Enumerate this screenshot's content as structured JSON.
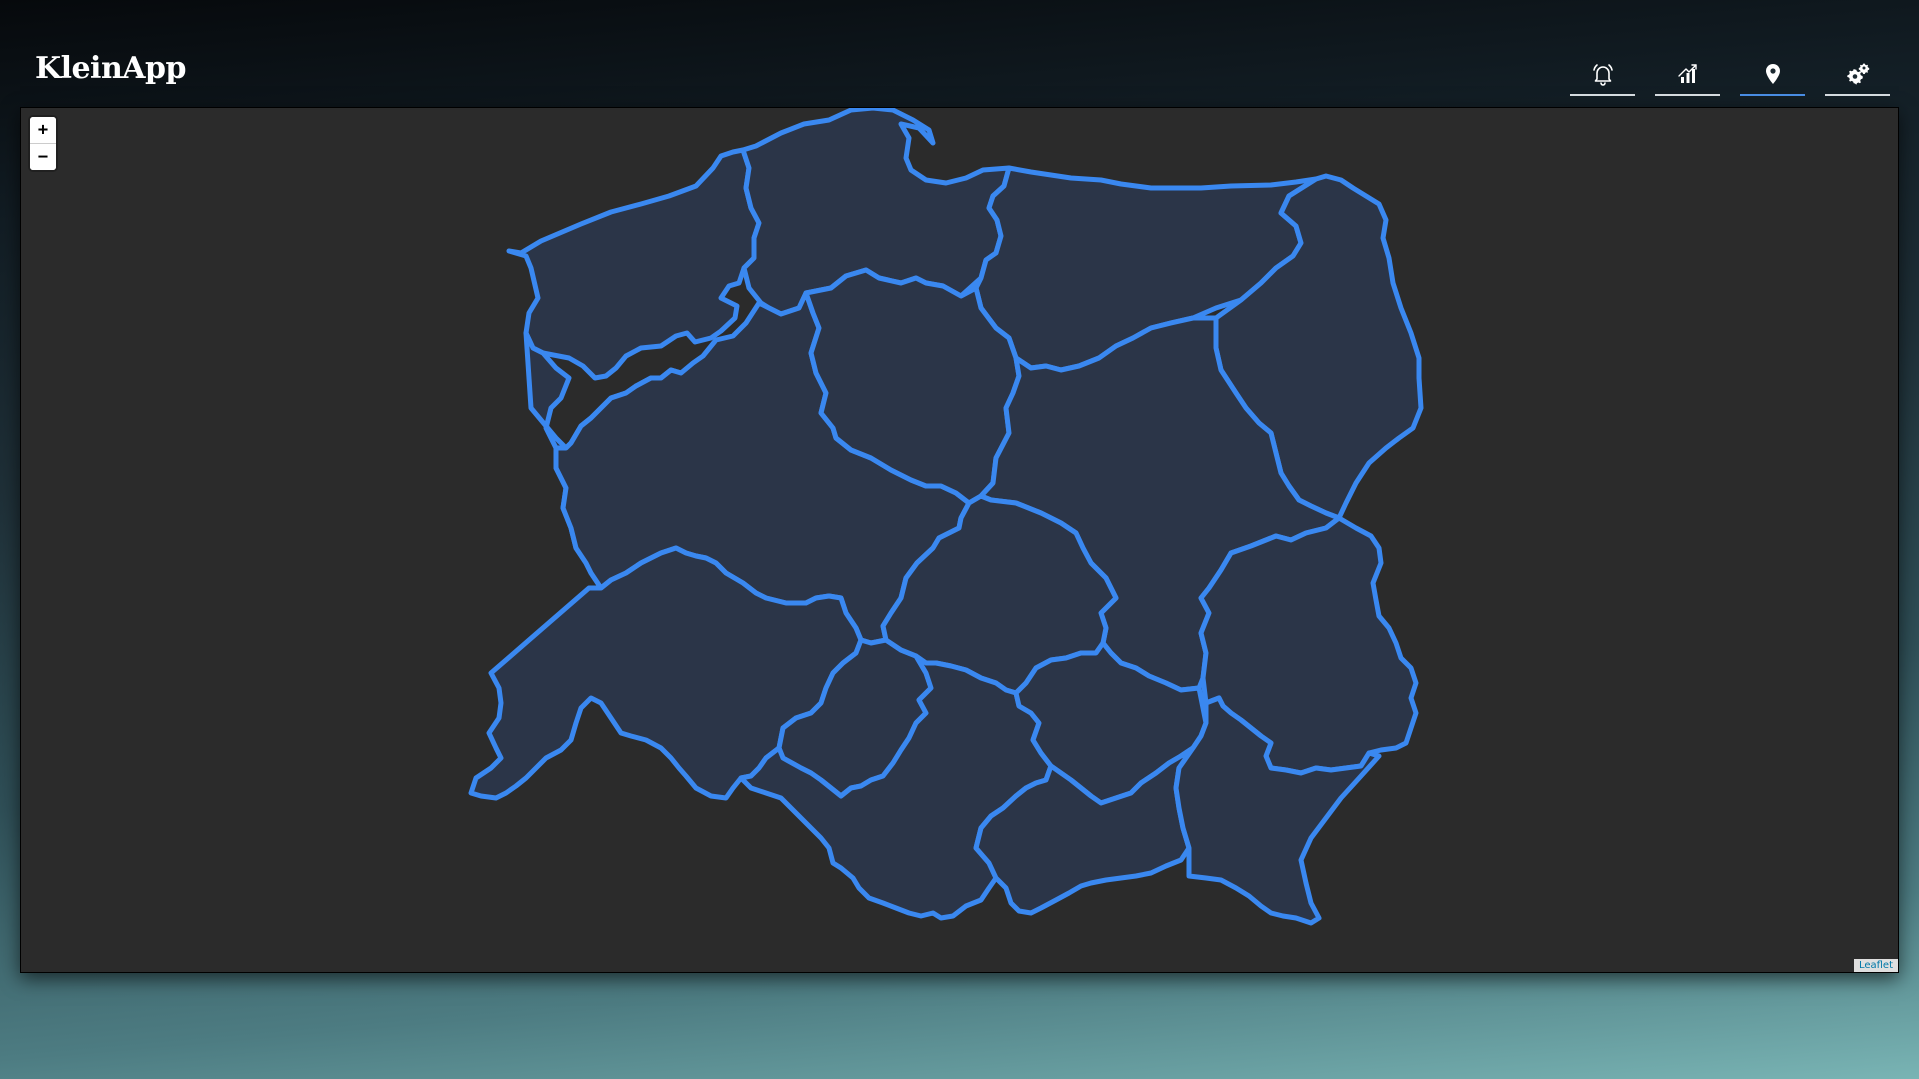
{
  "app": {
    "title": "KleinApp"
  },
  "nav": {
    "items": [
      {
        "name": "notifications",
        "icon": "bell-icon",
        "active": false
      },
      {
        "name": "statistics",
        "icon": "bar-chart-icon",
        "active": false
      },
      {
        "name": "map",
        "icon": "map-pin-icon",
        "active": true
      },
      {
        "name": "settings",
        "icon": "gears-icon",
        "active": false
      }
    ]
  },
  "map": {
    "zoom_in_label": "+",
    "zoom_out_label": "−",
    "attribution": "Leaflet",
    "region_fill": "#2b3548",
    "region_stroke": "#3a88f0",
    "background": "#2b2b2b"
  },
  "colors": {
    "nav_underline": "#d8dee2",
    "nav_active_underline": "#4a8fe6",
    "title": "#ffffff"
  }
}
